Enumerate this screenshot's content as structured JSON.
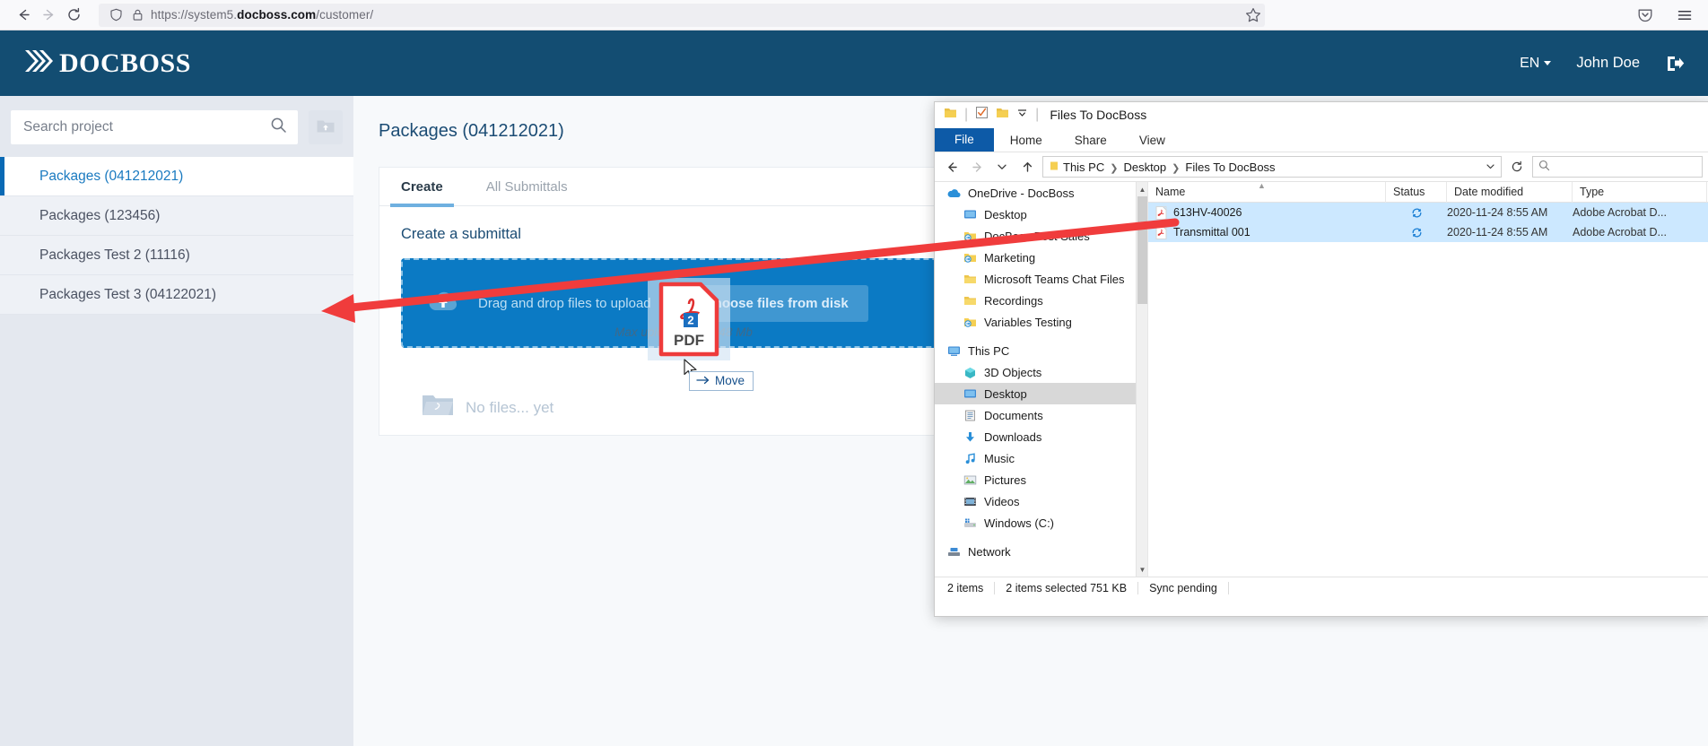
{
  "browser": {
    "back_icon": "back-arrow-icon",
    "forward_icon": "forward-arrow-icon",
    "reload_icon": "reload-icon",
    "shield_icon": "shield-icon",
    "lock_icon": "lock-icon",
    "url_prefix": "https://system5.",
    "url_domain": "docboss.com",
    "url_suffix": "/customer/",
    "url_full": "https://system5.docboss.com/customer/",
    "star_icon": "bookmark-star-icon",
    "pocket_icon": "save-to-pocket-icon",
    "menu_icon": "hamburger-menu-icon"
  },
  "app_header": {
    "logo_text": "DOCBOSS",
    "logo_mark": "chevrons-logo-icon",
    "language": "EN",
    "user_name": "John Doe",
    "logout_icon": "logout-icon",
    "background": "#134d72"
  },
  "sidebar": {
    "search": {
      "placeholder": "Search project",
      "value": "",
      "icon": "search-icon"
    },
    "folder_upload_icon": "folder-upload-icon",
    "items": [
      {
        "label": "Packages (041212021)",
        "active": true
      },
      {
        "label": "Packages (123456)",
        "active": false
      },
      {
        "label": "Packages Test 2 (11116)",
        "active": false
      },
      {
        "label": "Packages Test 3 (04122021)",
        "active": false
      }
    ]
  },
  "main": {
    "page_title": "Packages (041212021)",
    "tabs": [
      {
        "label": "Create",
        "active": true
      },
      {
        "label": "All Submittals",
        "active": false
      }
    ],
    "create_title": "Create a submittal",
    "dropzone": {
      "cloud_icon": "cloud-upload-icon",
      "text": "Drag and drop files to upload",
      "button_label": "Or choose files from disk",
      "max_note": "Max upload size 2048 Mb",
      "background": "#0b7ac4"
    },
    "empty_state": {
      "icon": "empty-folder-icon",
      "text": "No files... yet"
    }
  },
  "drag": {
    "ghost_icon": "pdf-file-icon",
    "ghost_label": "PDF",
    "badge_count": "2",
    "cursor_icon": "mouse-pointer-icon",
    "tooltip_arrow": "move-arrow-icon",
    "tooltip_label": "Move"
  },
  "annotation": {
    "arrow_icon": "red-arrow-icon",
    "color": "#f03c3c"
  },
  "explorer": {
    "titlebar": {
      "folder_icon": "folder-icon",
      "properties_icon": "properties-icon",
      "new_folder_icon": "new-folder-icon",
      "customize_icon": "customize-quick-access-icon",
      "title": "Files To DocBoss"
    },
    "ribbon_tabs": [
      "File",
      "Home",
      "Share",
      "View"
    ],
    "address": {
      "back_icon": "back-arrow-icon",
      "forward_icon": "forward-arrow-icon",
      "recent_icon": "recent-locations-icon",
      "up_icon": "up-arrow-icon",
      "folder_icon": "folder-icon",
      "crumbs": [
        "This PC",
        "Desktop",
        "Files To DocBoss"
      ],
      "dropdown_icon": "chevron-down-icon",
      "refresh_icon": "refresh-icon",
      "search_icon": "search-icon",
      "search_placeholder": ""
    },
    "tree": [
      {
        "label": "OneDrive - DocBoss",
        "icon": "onedrive-cloud-icon",
        "indent": false,
        "selected": false
      },
      {
        "label": "Desktop",
        "icon": "desktop-monitor-icon",
        "indent": true,
        "selected": false
      },
      {
        "label": "DocBoss Post Sales",
        "icon": "synced-folder-icon",
        "indent": true,
        "selected": false
      },
      {
        "label": "Marketing",
        "icon": "synced-folder-icon",
        "indent": true,
        "selected": false
      },
      {
        "label": "Microsoft Teams Chat Files",
        "icon": "folder-icon",
        "indent": true,
        "selected": false
      },
      {
        "label": "Recordings",
        "icon": "folder-icon",
        "indent": true,
        "selected": false
      },
      {
        "label": "Variables Testing",
        "icon": "synced-folder-icon",
        "indent": true,
        "selected": false
      },
      {
        "label": "This PC",
        "icon": "this-pc-icon",
        "indent": false,
        "selected": false
      },
      {
        "label": "3D Objects",
        "icon": "3d-objects-icon",
        "indent": true,
        "selected": false
      },
      {
        "label": "Desktop",
        "icon": "desktop-monitor-icon",
        "indent": true,
        "selected": true
      },
      {
        "label": "Documents",
        "icon": "documents-icon",
        "indent": true,
        "selected": false
      },
      {
        "label": "Downloads",
        "icon": "downloads-icon",
        "indent": true,
        "selected": false
      },
      {
        "label": "Music",
        "icon": "music-icon",
        "indent": true,
        "selected": false
      },
      {
        "label": "Pictures",
        "icon": "pictures-icon",
        "indent": true,
        "selected": false
      },
      {
        "label": "Videos",
        "icon": "videos-icon",
        "indent": true,
        "selected": false
      },
      {
        "label": "Windows (C:)",
        "icon": "drive-icon",
        "indent": true,
        "selected": false
      },
      {
        "label": "Network",
        "icon": "network-icon",
        "indent": false,
        "selected": false
      }
    ],
    "columns": [
      "Name",
      "Status",
      "Date modified",
      "Type"
    ],
    "files": [
      {
        "name": "613HV-40026",
        "icon": "pdf-file-icon",
        "status_icon": "sync-pending-icon",
        "date": "2020-11-24 8:55 AM",
        "type": "Adobe Acrobat D...",
        "selected": true
      },
      {
        "name": "Transmittal 001",
        "icon": "pdf-file-icon",
        "status_icon": "sync-pending-icon",
        "date": "2020-11-24 8:55 AM",
        "type": "Adobe Acrobat D...",
        "selected": true
      }
    ],
    "status_bar": {
      "items": [
        "2 items",
        "2 items selected  751 KB",
        "Sync pending"
      ]
    }
  }
}
